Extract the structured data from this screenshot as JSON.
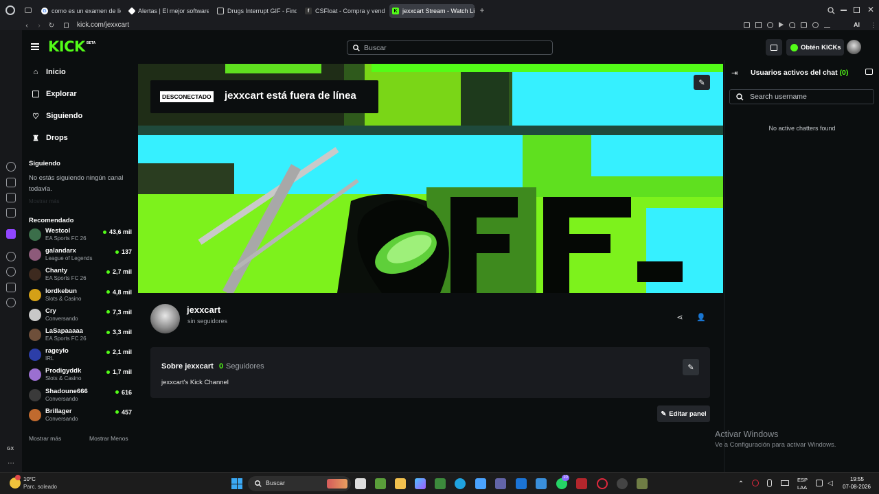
{
  "browser": {
    "tabs": [
      {
        "title": "como es un examen de lice",
        "fav": "G"
      },
      {
        "title": "Alertas | El mejor software",
        "fav": ""
      },
      {
        "title": "Drugs Interrupt GIF - Find &",
        "fav": ""
      },
      {
        "title": "CSFloat - Compra y vende",
        "fav": "f"
      },
      {
        "title": "jexxcart Stream - Watch Li",
        "fav": "K"
      }
    ],
    "url": "kick.com/jexxcart",
    "ai_label": "AI"
  },
  "header": {
    "logo": "KICK",
    "logo_badge": "BETA",
    "search_placeholder": "Buscar",
    "get_kicks": "Obtén KICKs"
  },
  "sidebar": {
    "nav": [
      {
        "label": "Inicio",
        "icon": "home-icon"
      },
      {
        "label": "Explorar",
        "icon": "browse-icon"
      },
      {
        "label": "Siguiendo",
        "icon": "heart-icon"
      },
      {
        "label": "Drops",
        "icon": "drops-icon"
      }
    ],
    "following_title": "Siguiendo",
    "following_empty": "No estás siguiendo ningún canal todavía.",
    "following_more": "Mostrar más",
    "recommended_title": "Recomendado",
    "recommended": [
      {
        "name": "Westcol",
        "game": "EA Sports FC 26",
        "viewers": "43,6 mil",
        "color": "#3b6e4a"
      },
      {
        "name": "galandarx",
        "game": "League of Legends",
        "viewers": "137",
        "color": "#8d5a7a"
      },
      {
        "name": "Chanty",
        "game": "EA Sports FC 26",
        "viewers": "2,7 mil",
        "color": "#3d2a1f"
      },
      {
        "name": "lordkebun",
        "game": "Slots & Casino",
        "viewers": "4,8 mil",
        "color": "#d4a017"
      },
      {
        "name": "Cry",
        "game": "Conversando",
        "viewers": "7,3 mil",
        "color": "#c8c8c8"
      },
      {
        "name": "LaSapaaaaa",
        "game": "EA Sports FC 26",
        "viewers": "3,3 mil",
        "color": "#6e4f3a"
      },
      {
        "name": "rageylo",
        "game": "IRL",
        "viewers": "2,1 mil",
        "color": "#2c3ea8"
      },
      {
        "name": "Prodigyddk",
        "game": "Slots & Casino",
        "viewers": "1,7 mil",
        "color": "#9b6fd1"
      },
      {
        "name": "Shadoune666",
        "game": "Conversando",
        "viewers": "616",
        "color": "#3a3a3a"
      },
      {
        "name": "Brillager",
        "game": "Conversando",
        "viewers": "457",
        "color": "#c06a2e"
      }
    ],
    "show_more": "Mostrar más",
    "show_less": "Mostrar Menos"
  },
  "banner": {
    "offline_badge": "DESCONECTADO",
    "offline_text": "jexxcart está fuera de línea",
    "big_text": "OFF-"
  },
  "channel": {
    "name": "jexxcart",
    "followers_text": "sin seguidores",
    "about_title": "Sobre jexxcart",
    "follower_count": "0",
    "followers_label": "Seguidores",
    "description": "jexxcart's Kick Channel",
    "edit_panel": "Editar panel"
  },
  "chat": {
    "title": "Usuarios activos del chat",
    "count": "(0)",
    "search_placeholder": "Search username",
    "empty": "No active chatters found"
  },
  "watermark": {
    "title": "Activar Windows",
    "subtitle": "Ve a Configuración para activar Windows."
  },
  "taskbar": {
    "weather_temp": "10°C",
    "weather_desc": "Parc. soleado",
    "search": "Buscar",
    "lang": "ESP",
    "lang2": "LAA",
    "time": "19:55",
    "date": "07-08-2026",
    "badge": "10"
  },
  "colors": {
    "accent": "#53fc18",
    "background": "#0b0e0f"
  }
}
